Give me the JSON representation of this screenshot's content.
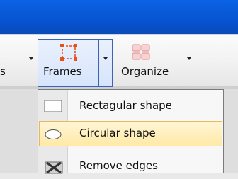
{
  "ribbon": {
    "left_group_label_fragment": "s",
    "frames_label": "Frames",
    "organize_label": "Organize"
  },
  "menu": {
    "items": [
      {
        "label": "Rectagular shape",
        "icon": "rectangle-shape-icon",
        "selected": false
      },
      {
        "label": "Circular shape",
        "icon": "ellipse-shape-icon",
        "selected": true
      },
      {
        "label": "Remove edges",
        "icon": "remove-edges-icon",
        "selected": false
      }
    ]
  },
  "colors": {
    "title_bar": "#0751cc",
    "selection_fill": "#ffe9a6",
    "selection_border": "#e8b85a",
    "frames_accent": "#e8501a"
  }
}
